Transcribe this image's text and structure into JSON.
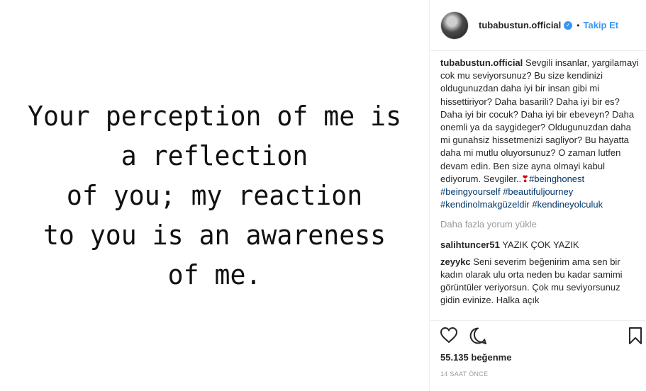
{
  "post": {
    "quote_lines": [
      "Your perception of me is",
      "a reflection",
      "of you; my reaction",
      "to you is an awareness",
      "of me."
    ]
  },
  "header": {
    "username": "tubabustun.official",
    "verified_symbol": "✓",
    "separator": "•",
    "follow_label": "Takip Et"
  },
  "caption": {
    "username": "tubabustun.official",
    "text": "Sevgili insanlar, yargilamayi cok mu seviyorsunuz? Bu size kendinizi oldugunuzdan daha iyi bir insan gibi mi hissettiriyor? Daha basarili? Daha iyi bir es? Daha iyi bir cocuk? Daha iyi bir ebeveyn? Daha onemli ya da saygideger? Oldugunuzdan daha mi gunahsiz hissetmenizi sagliyor? Bu hayatta daha mi mutlu oluyorsunuz? O zaman lutfen devam edin. Ben size ayna olmayi kabul ediyorum. Sevgiler..",
    "heart": "❣",
    "hashtags": [
      "#beinghonest",
      "#beingyourself",
      "#beautifuljourney",
      "#kendinolmakgüzeldir",
      "#kendineyolculuk"
    ]
  },
  "load_more": "Daha fazla yorum yükle",
  "comments": [
    {
      "user": "salihtuncer51",
      "text": "YAZIK ÇOK YAZIK"
    },
    {
      "user": "zeyykc",
      "text": "Seni severim beğenirim ama sen bir kadın olarak ulu orta neden bu kadar samimi görüntüler veriyorsun. Çok mu seviyorsunuz gidin evinize. Halka açık"
    }
  ],
  "likes": "55.135 beğenme",
  "timestamp": "14 SAAT ÖNCE",
  "icons": {
    "like": "heart-outline-icon",
    "comment": "comment-bubble-icon",
    "save": "bookmark-icon"
  },
  "colors": {
    "link": "#3897f0",
    "hashtag": "#003569",
    "muted": "#999999",
    "heart": "#d0021b"
  }
}
